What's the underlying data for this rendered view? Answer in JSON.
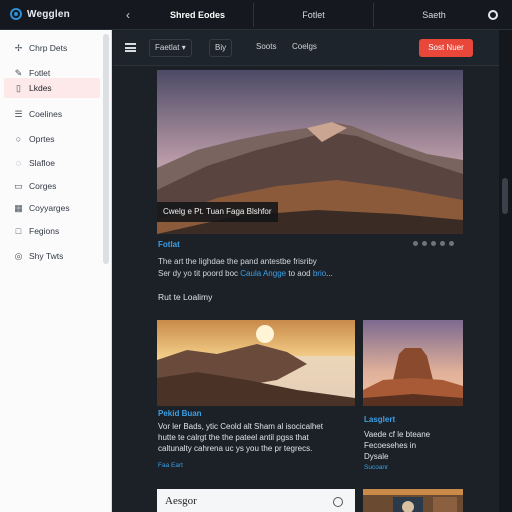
{
  "app": {
    "name": "Wegglen"
  },
  "topbar": {
    "back_label": "‹",
    "tabs": [
      "Shred Eodes",
      "Fotlet",
      "Saeth"
    ],
    "right_icon": "circle-icon"
  },
  "sidebar": {
    "items": [
      {
        "label": "Chrp Dets",
        "icon": "sparkle-icon",
        "glyph": "✢"
      },
      {
        "label": "Fotlet",
        "icon": "pen-icon",
        "glyph": "✎"
      },
      {
        "label": "Lkdes",
        "icon": "bookmark-icon",
        "glyph": "▯",
        "active": true
      },
      {
        "label": "Coelines",
        "icon": "list-icon",
        "glyph": "☰"
      },
      {
        "label": "Oprtes",
        "icon": "circle-icon",
        "glyph": "○"
      },
      {
        "label": "Slafloe",
        "icon": "chat-icon",
        "glyph": "◌"
      },
      {
        "label": "Corges",
        "icon": "folder-icon",
        "glyph": "▭"
      },
      {
        "label": "Coyyarges",
        "icon": "grid-icon",
        "glyph": "▦"
      },
      {
        "label": "Fegions",
        "icon": "page-icon",
        "glyph": "□"
      },
      {
        "label": "Shy Twts",
        "icon": "globe-icon",
        "glyph": "◎"
      }
    ]
  },
  "toolbar": {
    "filter": "Faetlat",
    "filter_arrow": "▾",
    "view": "Biy",
    "sort": "Soots",
    "more": "Coelgs",
    "action_button": "Sost Nuer"
  },
  "feed": {
    "hero": {
      "caption": "Cwelg e Pt. Tuan Faga Blshfor",
      "tag": "Fotlat",
      "desc_line1": "The art the lighdae the pand antestbe frisriby",
      "desc_line2_pre": "Ser dy yo tit poord boc",
      "desc_link1": "Caula Angge",
      "desc_line2_mid": "to aod",
      "desc_link2": "brio",
      "desc_line2_post": "..."
    },
    "section_title": "Rut te Loalimy",
    "cards": [
      {
        "title": "Pekid Buan",
        "text": [
          "Vor ler Bads, ytic Ceold alt Sham al isocicalhet",
          "hutte te calrgt the the pateel antil pgss that",
          "caltunalty cahrena uc ys you the pr tegrecs."
        ],
        "meta": "Faa Eart"
      },
      {
        "title": "Lasglert",
        "text": [
          "Vaede cf le bteane",
          "Fecoesehes in",
          "Dysale"
        ],
        "meta": "Sucoanr"
      }
    ],
    "bottom_card_title": "Aesgor"
  },
  "colors": {
    "accent_blue": "#3aa0e6",
    "action_red": "#e8473a",
    "active_item_bg": "#fde9ea"
  }
}
